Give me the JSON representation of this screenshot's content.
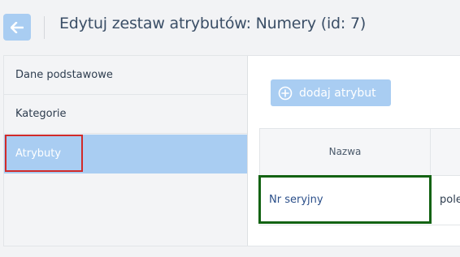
{
  "header": {
    "back_icon": "arrow-left-icon",
    "title": "Edytuj zestaw atrybutów: Numery (id: 7)"
  },
  "sidebar": {
    "items": [
      {
        "label": "Dane podstawowe",
        "active": false
      },
      {
        "label": "Kategorie",
        "active": false
      },
      {
        "label": "Atrybuty",
        "active": true
      }
    ]
  },
  "main": {
    "add_button": {
      "icon": "plus-circle-icon",
      "label": "dodaj atrybut"
    },
    "table": {
      "headers": [
        "Nazwa"
      ],
      "rows": [
        {
          "name": "Nr seryjny",
          "type": "pole"
        }
      ]
    }
  },
  "colors": {
    "accent": "#a9cdf2",
    "title_text": "#3a4e66",
    "link_text": "#2b4f8a",
    "highlight_red": "#d02a2a",
    "highlight_green": "#136313"
  }
}
